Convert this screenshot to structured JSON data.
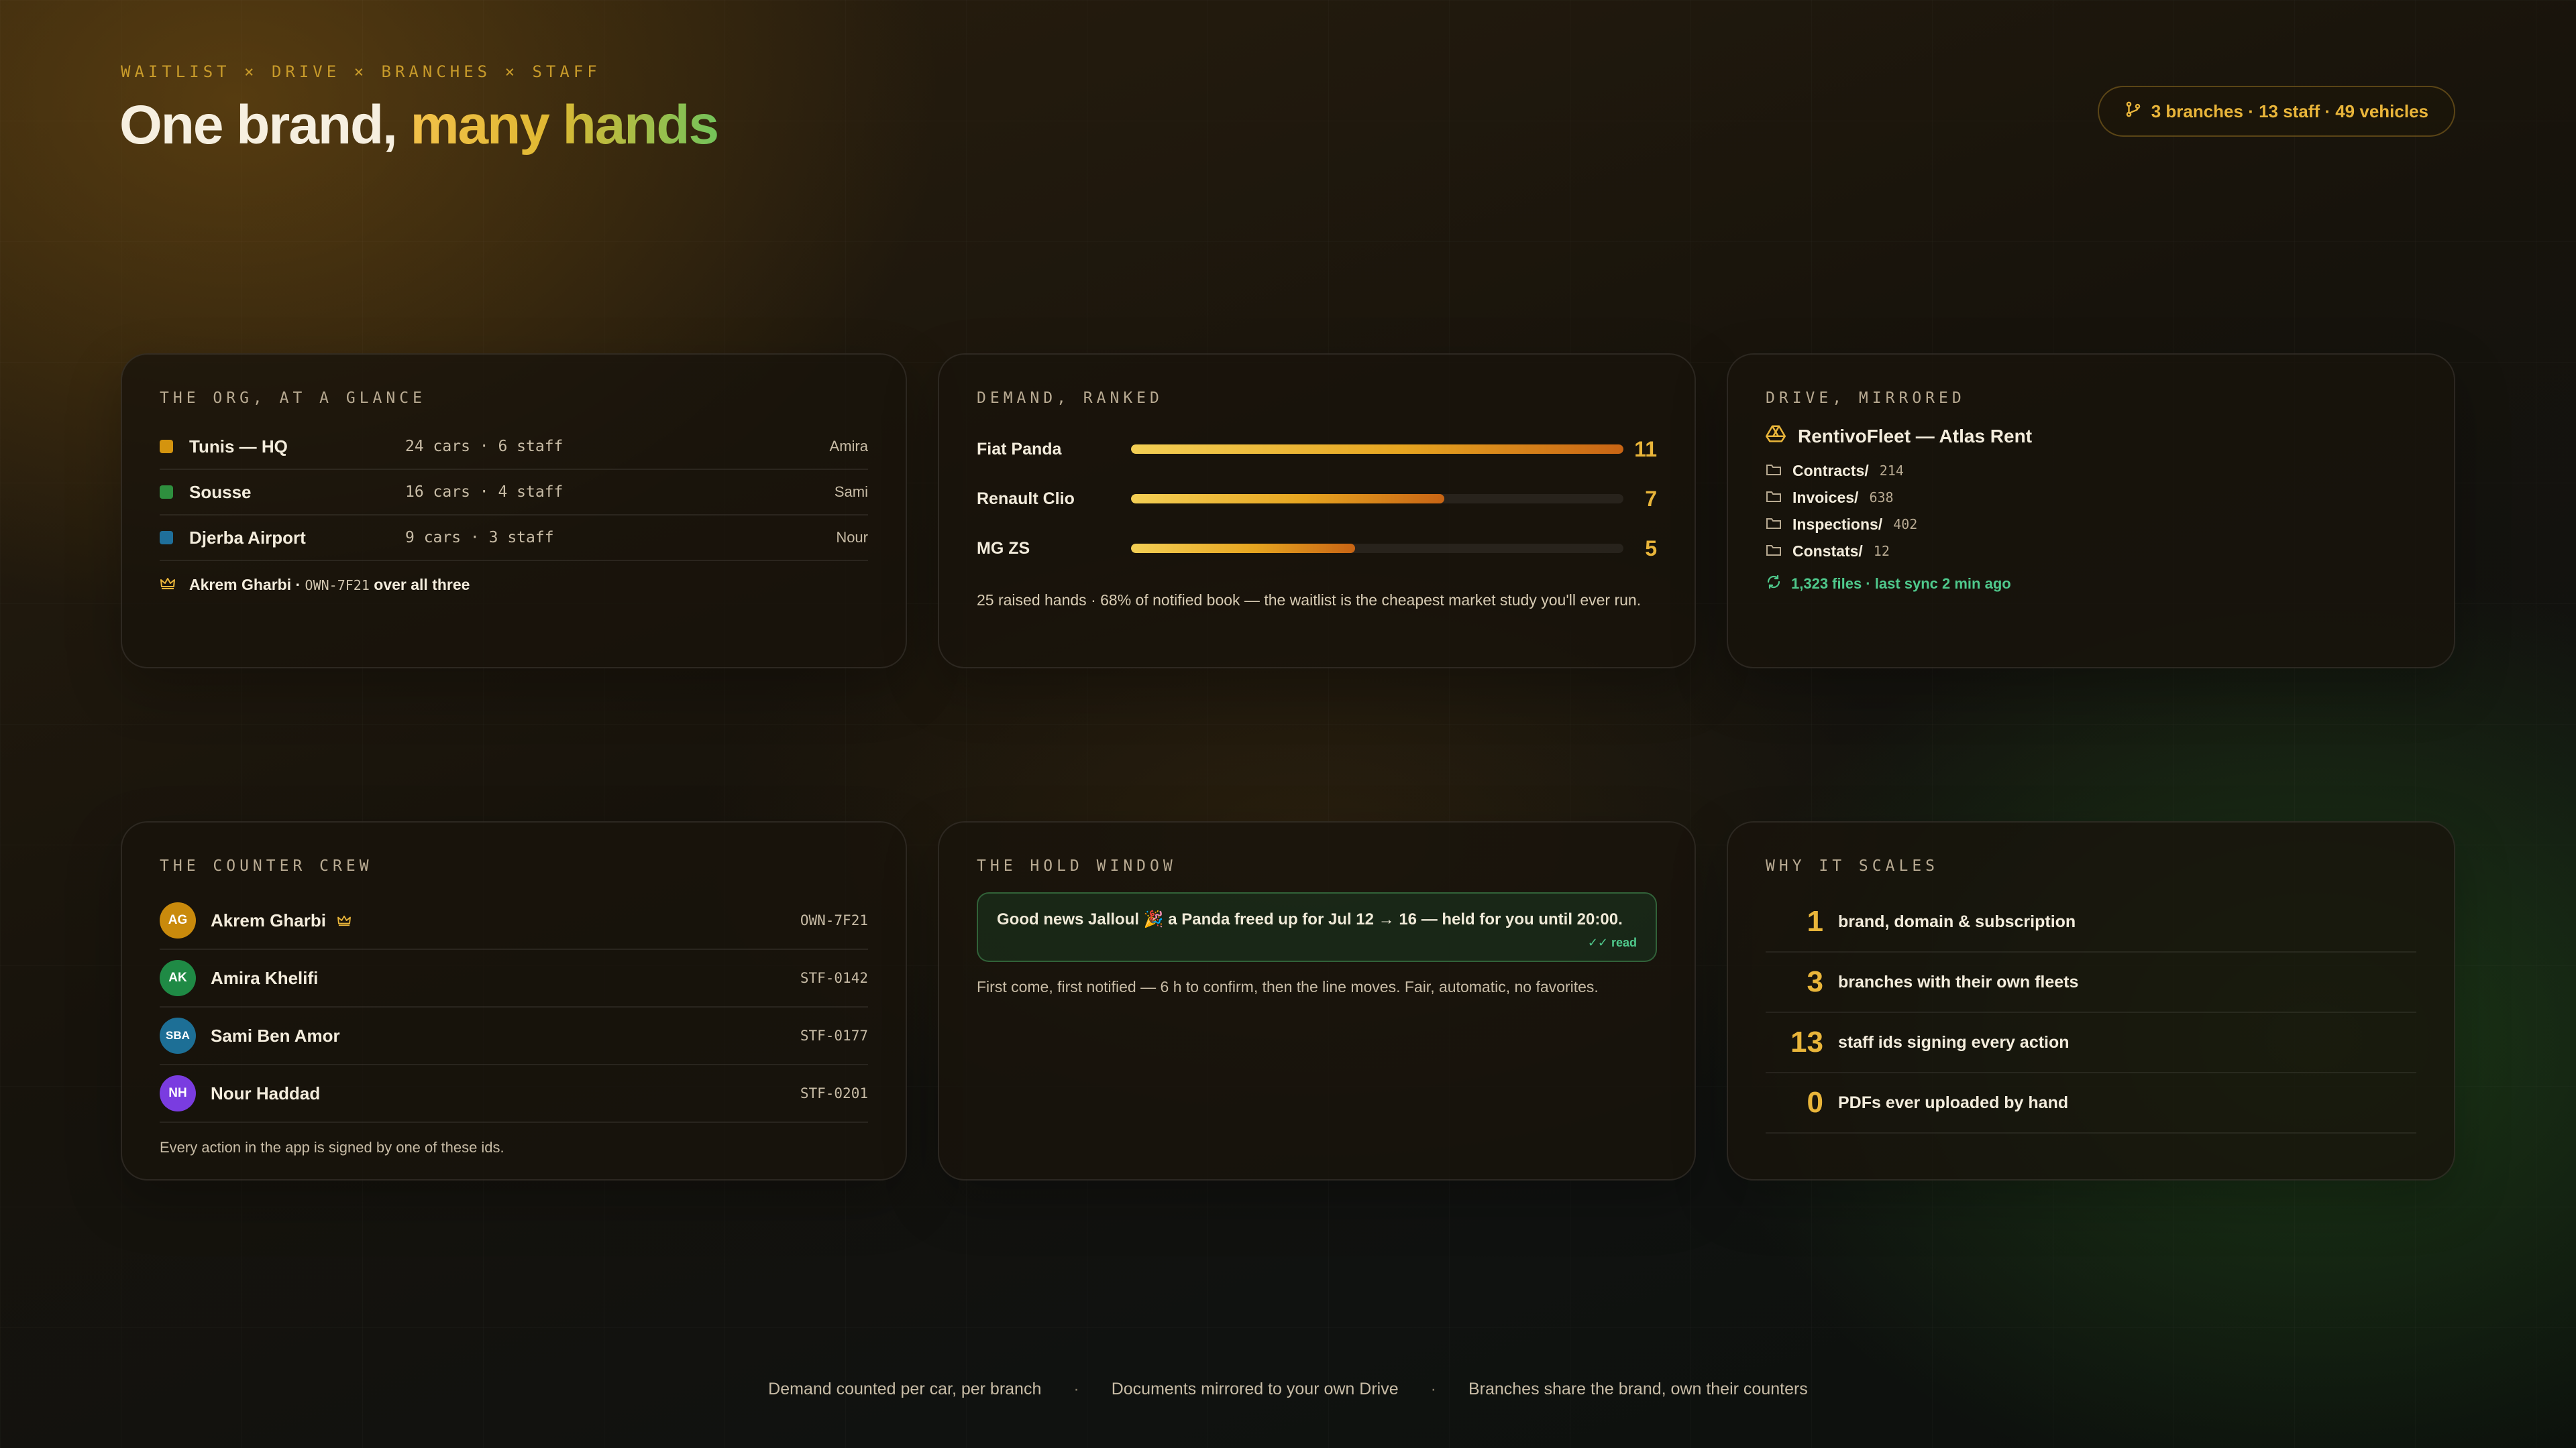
{
  "header": {
    "eyebrow": "WAITLIST × DRIVE × BRANCHES × STAFF",
    "title_plain": "One brand,",
    "title_highlight": "many hands",
    "summary_pill": "3 branches · 13 staff · 49 vehicles"
  },
  "org": {
    "title": "THE ORG, AT A GLANCE",
    "branches": [
      {
        "name": "Tunis — HQ",
        "meta": "24 cars · 6 staff",
        "lead": "Amira",
        "color": "#d4940f"
      },
      {
        "name": "Sousse",
        "meta": "16 cars · 4 staff",
        "lead": "Sami",
        "color": "#2e8f3e"
      },
      {
        "name": "Djerba Airport",
        "meta": "9 cars · 3 staff",
        "lead": "Nour",
        "color": "#1f6f9a"
      }
    ],
    "owner_name": "Akrem Gharbi ·",
    "owner_id": "OWN-7F21",
    "owner_suffix": "over all three"
  },
  "demand": {
    "title": "DEMAND, RANKED",
    "max": 11,
    "items": [
      {
        "label": "Fiat Panda",
        "value": 11
      },
      {
        "label": "Renault Clio",
        "value": 7
      },
      {
        "label": "MG ZS",
        "value": 5
      }
    ],
    "note": "25 raised hands · 68% of notified book — the waitlist is the cheapest market study you'll ever run."
  },
  "drive": {
    "title": "DRIVE, MIRRORED",
    "account": "RentivoFleet — Atlas Rent",
    "folders": [
      {
        "name": "Contracts/",
        "count": "214"
      },
      {
        "name": "Invoices/",
        "count": "638"
      },
      {
        "name": "Inspections/",
        "count": "402"
      },
      {
        "name": "Constats/",
        "count": "12"
      }
    ],
    "sync": "1,323 files · last sync 2 min ago"
  },
  "crew": {
    "title": "THE COUNTER CREW",
    "members": [
      {
        "initials": "AG",
        "name": "Akrem Gharbi",
        "id": "OWN-7F21",
        "color": "#c98a0c"
      },
      {
        "initials": "AK",
        "name": "Amira Khelifi",
        "id": "STF-0142",
        "color": "#1f8a45"
      },
      {
        "initials": "SBA",
        "name": "Sami Ben Amor",
        "id": "STF-0177",
        "color": "#1d6f96"
      },
      {
        "initials": "NH",
        "name": "Nour Haddad",
        "id": "STF-0201",
        "color": "#7a3ce0"
      }
    ],
    "note": "Every action in the app is signed by one of these ids."
  },
  "hold": {
    "title": "THE HOLD WINDOW",
    "message": "Good news Jalloul 🎉 a Panda freed up for Jul 12 → 16 — held for you until 20:00.",
    "read": "✓✓ read",
    "note": "First come, first notified — 6 h to confirm, then the line moves. Fair, automatic, no favorites."
  },
  "scales": {
    "title": "WHY IT SCALES",
    "stats": [
      {
        "num": "1",
        "label": "brand, domain & subscription"
      },
      {
        "num": "3",
        "label": "branches with their own fleets"
      },
      {
        "num": "13",
        "label": "staff ids signing every action"
      },
      {
        "num": "0",
        "label": "PDFs ever uploaded by hand"
      }
    ]
  },
  "footer": [
    "Demand counted per car, per branch",
    "Documents mirrored to your own Drive",
    "Branches share the brand, own their counters"
  ],
  "colors": {
    "accent": "#e9b53a",
    "sync": "#4fc98c"
  }
}
